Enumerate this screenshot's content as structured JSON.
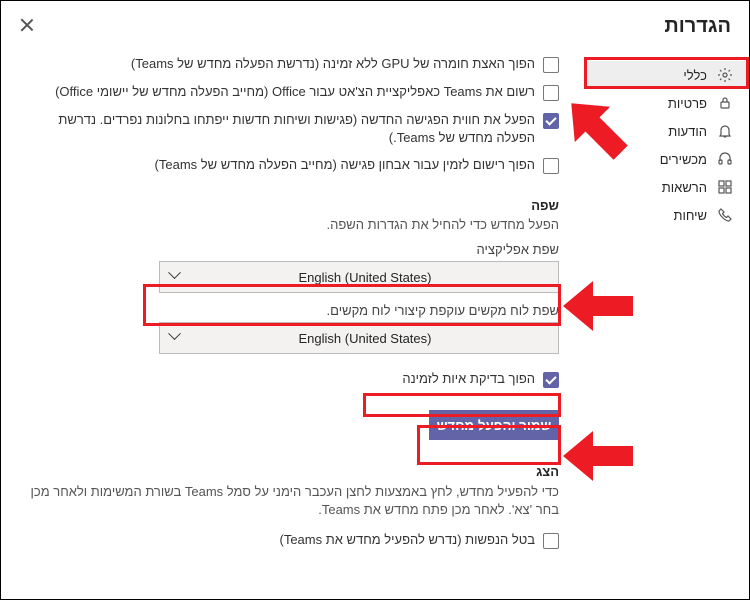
{
  "title": "הגדרות",
  "sidebar": {
    "items": [
      {
        "label": "כללי"
      },
      {
        "label": "פרטיות"
      },
      {
        "label": "הודעות"
      },
      {
        "label": "מכשירים"
      },
      {
        "label": "הרשאות"
      },
      {
        "label": "שיחות"
      }
    ]
  },
  "checks": {
    "gpu": "הפוך האצת חומרה של GPU ללא זמינה (נדרשת הפעלה מחדש של Teams)",
    "office": "רשום את Teams כאפליקציית הצ'אט עבור Office (מחייב הפעלה מחדש של יישומי Office)",
    "newmtg": "הפעל את חווית הפגישה החדשה (פגישות ושיחות חדשות ייפתחו בחלונות נפרדים. נדרשת הפעלה מחדש של Teams.)",
    "diag": "הפוך רישום לזמין עבור אבחון פגישה (מחייב הפעלה מחדש של Teams)"
  },
  "lang": {
    "heading": "שפה",
    "sub": "הפעל מחדש כדי להחיל את הגדרות השפה.",
    "appLabel": "שפת אפליקציה",
    "appValue": "English (United States)",
    "kbLabel": "שפת לוח מקשים עוקפת קיצורי לוח מקשים.",
    "kbValue": "English (United States)",
    "spellcheck": "הפוך בדיקת איות לזמינה",
    "saveBtn": "שמור והפעל מחדש"
  },
  "display": {
    "heading": "הצג",
    "sub": "כדי להפעיל מחדש, לחץ באמצעות לחצן העכבר הימני על סמל Teams בשורת המשימות ולאחר מכן בחר 'צא'. לאחר מכן פתח מחדש את Teams.",
    "anim": "בטל הנפשות (נדרש להפעיל מחדש את Teams)"
  }
}
